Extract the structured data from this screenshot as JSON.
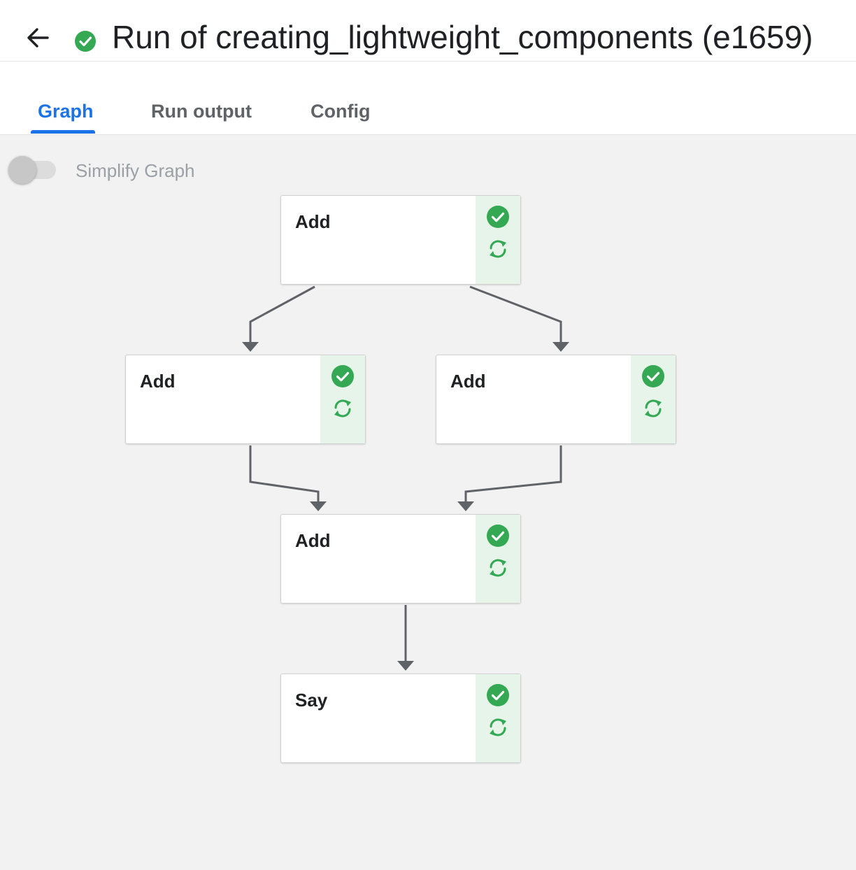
{
  "header": {
    "back_icon": "arrow-left-icon",
    "status_icon": "check-circle-icon",
    "title": "Run of creating_lightweight_components (e1659)"
  },
  "tabs": [
    {
      "label": "Graph",
      "active": true
    },
    {
      "label": "Run output",
      "active": false
    },
    {
      "label": "Config",
      "active": false
    }
  ],
  "toolbar": {
    "simplify_graph_label": "Simplify Graph",
    "simplify_graph_enabled": false
  },
  "graph": {
    "nodes": [
      {
        "id": "add-1",
        "label": "Add",
        "status": "succeeded",
        "cached": true
      },
      {
        "id": "add-2",
        "label": "Add",
        "status": "succeeded",
        "cached": true
      },
      {
        "id": "add-3",
        "label": "Add",
        "status": "succeeded",
        "cached": true
      },
      {
        "id": "add-4",
        "label": "Add",
        "status": "succeeded",
        "cached": true
      },
      {
        "id": "say",
        "label": "Say",
        "status": "succeeded",
        "cached": true
      }
    ],
    "edges": [
      {
        "from": "add-1",
        "to": "add-2"
      },
      {
        "from": "add-1",
        "to": "add-3"
      },
      {
        "from": "add-2",
        "to": "add-4"
      },
      {
        "from": "add-3",
        "to": "add-4"
      },
      {
        "from": "add-4",
        "to": "say"
      }
    ]
  },
  "colors": {
    "accent": "#1a73e8",
    "success": "#34a853",
    "status_panel": "#e6f4ea",
    "edge": "#5f6368"
  }
}
